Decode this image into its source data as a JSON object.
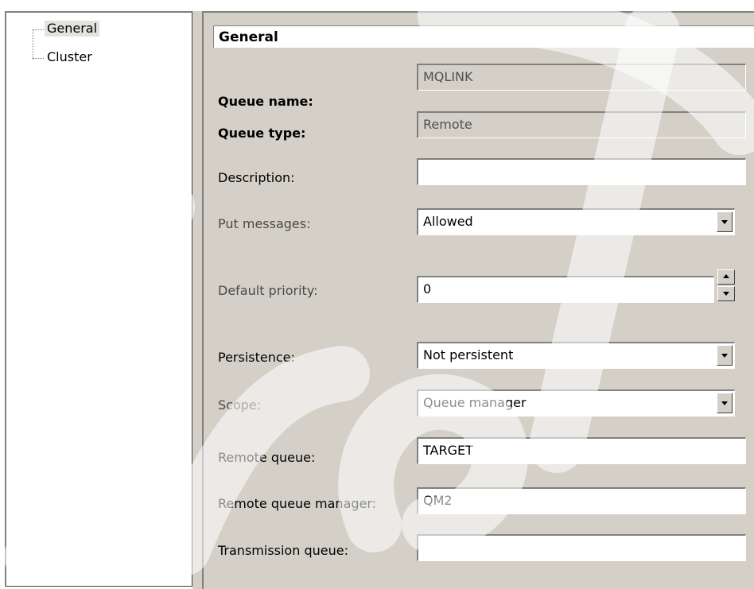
{
  "tree": {
    "items": [
      {
        "label": "General",
        "selected": true
      },
      {
        "label": "Cluster",
        "selected": false
      }
    ]
  },
  "panel": {
    "header": "General",
    "fields": {
      "queue_name": {
        "label": "Queue name:",
        "value": "MQLINK"
      },
      "queue_type": {
        "label": "Queue type:",
        "value": "Remote"
      },
      "description": {
        "label": "Description:",
        "value": ""
      },
      "put_messages": {
        "label": "Put messages:",
        "value": "Allowed"
      },
      "default_priority": {
        "label": "Default priority:",
        "value": "0"
      },
      "persistence": {
        "label": "Persistence:",
        "value": "Not persistent"
      },
      "scope": {
        "label": "Scope:",
        "value": "Queue manager"
      },
      "remote_queue": {
        "label": "Remote queue:",
        "value": "TARGET"
      },
      "remote_queue_manager": {
        "label": "Remote queue manager:",
        "value": "QM2"
      },
      "transmission_queue": {
        "label": "Transmission queue:",
        "value": ""
      }
    }
  },
  "colors": {
    "panel_bg": "#d4d0c8",
    "field_bg": "#ffffff",
    "readonly_field_bg": "#d4d0c8"
  }
}
